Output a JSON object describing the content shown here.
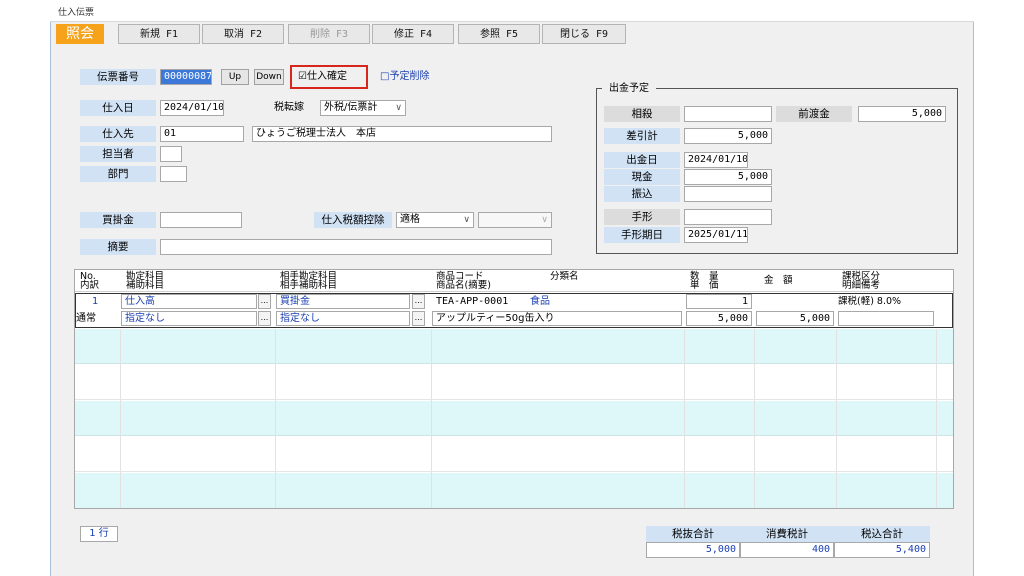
{
  "window": {
    "title": "仕入伝票"
  },
  "mode": "照会",
  "toolbar": [
    {
      "label": "新規 F1",
      "enabled": true
    },
    {
      "label": "取消 F2",
      "enabled": true
    },
    {
      "label": "削除 F3",
      "enabled": false
    },
    {
      "label": "修正 F4",
      "enabled": true
    },
    {
      "label": "参照 F5",
      "enabled": true
    },
    {
      "label": "閉じる F9",
      "enabled": true
    }
  ],
  "header": {
    "slip_no_label": "伝票番号",
    "slip_no": "00000087",
    "up_label": "Up",
    "down_label": "Down",
    "confirm_label": "☑仕入確定",
    "delete_schedule_label": "□予定削除",
    "date_label": "仕入日",
    "date": "2024/01/10",
    "tax_mode_label": "税転嫁",
    "tax_mode": "外税/伝票計",
    "supplier_label": "仕入先",
    "supplier_code": "01",
    "supplier_name": "ひょうご税理士法人　本店",
    "person_label": "担当者",
    "dept_label": "部門",
    "payable_label": "買掛金",
    "tax_deduct_label": "仕入税額控除",
    "tax_deduct": "適格",
    "memo_label": "摘要"
  },
  "payment": {
    "title": "出金予定",
    "offset_label": "相殺",
    "advance_label": "前渡金",
    "advance_value": "5,000",
    "diff_label": "差引計",
    "diff_value": "5,000",
    "pay_date_label": "出金日",
    "pay_date": "2024/01/10",
    "cash_label": "現金",
    "cash_value": "5,000",
    "transfer_label": "振込",
    "bill_label": "手形",
    "bill_due_label": "手形期日",
    "bill_due": "2025/01/11"
  },
  "table": {
    "headers": {
      "no": "No.",
      "detail": "内訳",
      "account": "勘定科目",
      "sub_account": "補助科目",
      "counter_account": "相手勘定科目",
      "counter_sub": "相手補助科目",
      "product_code": "商品コード",
      "category": "分類名",
      "product_name": "商品名(摘要)",
      "qty": "数　量",
      "unit_price": "単　価",
      "amount": "金　額",
      "tax_class": "課税区分",
      "note": "明細備考"
    },
    "row": {
      "no": "1",
      "detail": "通常",
      "account": "仕入高",
      "sub_account": "指定なし",
      "counter_account": "買掛金",
      "counter_sub": "指定なし",
      "product_code": "TEA-APP-0001",
      "category": "食品",
      "product_name": "アップルティー50g缶入り",
      "qty": "1",
      "unit_price": "5,000",
      "amount": "5,000",
      "tax_class": "課税(軽) 8.0%",
      "dots": "..."
    }
  },
  "footer": {
    "rows": "1 行",
    "subtotal_label": "税抜合計",
    "tax_label": "消費税計",
    "total_label": "税込合計",
    "subtotal": "5,000",
    "tax": "400",
    "total": "5,400"
  },
  "colors": {
    "accent": "#f6a21a",
    "label_bg": "#d1e2f5",
    "row_alt": "#def7f8",
    "highlight": "#d9261c"
  }
}
